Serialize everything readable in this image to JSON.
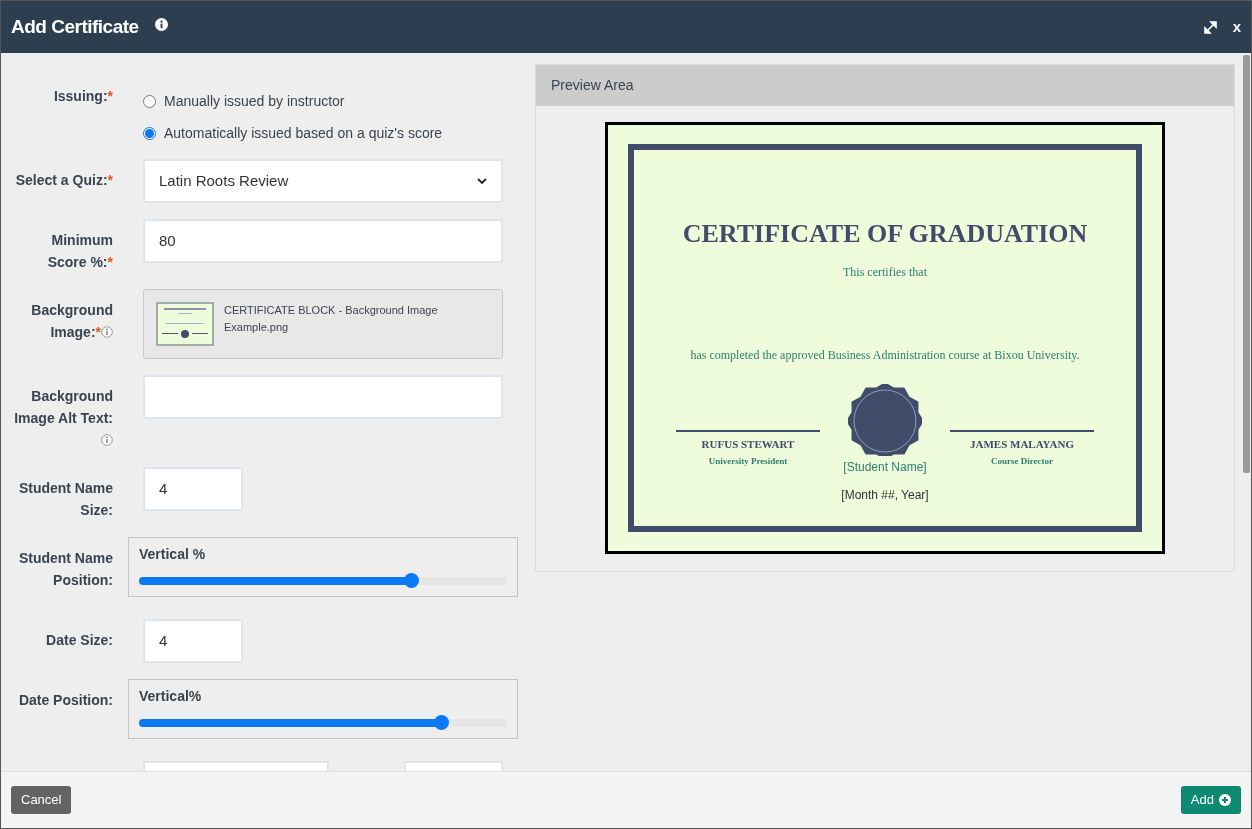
{
  "window": {
    "title": "Add Certificate",
    "close_label": "x"
  },
  "issuing": {
    "label": "Issuing:",
    "required_mark": "*",
    "options": [
      {
        "label": "Manually issued by instructor",
        "selected": false
      },
      {
        "label": "Automatically issued based on a quiz's score",
        "selected": true
      }
    ]
  },
  "fields": [
    {
      "kind": "select",
      "label": "Select a Quiz:",
      "required_mark": "*",
      "value": "Latin Roots Review"
    },
    {
      "kind": "text",
      "label": "Minimum Score %:",
      "required_mark": "*",
      "value": "80"
    },
    {
      "kind": "file",
      "label": "Background Image:",
      "required_mark": "*",
      "info": true,
      "file_name": "CERTIFICATE BLOCK - Background Image Example.png"
    },
    {
      "kind": "text",
      "label": "Background Image Alt Text:",
      "info": true
    },
    {
      "kind": "number",
      "label": "Student Name Size:",
      "value": "4"
    },
    {
      "kind": "slider",
      "label": "Student Name Position:",
      "caption": "Vertical %",
      "level": 0.74
    },
    {
      "kind": "number",
      "label": "Date Size:",
      "value": "4"
    },
    {
      "kind": "slider",
      "label": "Date Position:",
      "caption": "Vertical%",
      "level": 0.82
    }
  ],
  "preview": {
    "title": "Preview Area",
    "certificate": {
      "heading": "CERTIFICATE OF GRADUATION",
      "intro": "This certifies that",
      "body": "has completed the approved Business Administration course at Bixou University.",
      "signatories": [
        {
          "name": "RUFUS STEWART",
          "role": "University President"
        },
        {
          "name": "JAMES MALAYANG",
          "role": "Course Director"
        }
      ],
      "student_name": "[Student Name]",
      "date": "[Month ##, Year]"
    }
  },
  "footer": {
    "cancel": "Cancel",
    "add": "Add"
  }
}
